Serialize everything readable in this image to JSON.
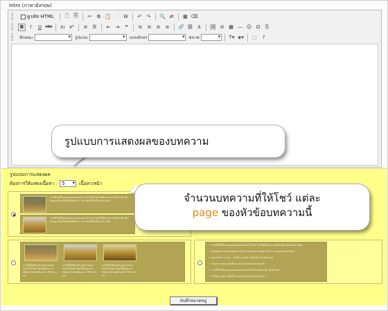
{
  "section_label": "Intro (ภาษาอังกฤษ)",
  "toolbar": {
    "source_label": "ดูรหัส HTML",
    "row2_buttons": [
      "B",
      "I",
      "U",
      "ABC",
      "x₂",
      "x²"
    ],
    "style_label": "ลักษณะ",
    "format_label": "รูปแบบ",
    "font_label": "แบบอักษร",
    "size_label": "ขนาด"
  },
  "callout_top": "รูปแบบการแสดงผลของบทความ",
  "format_panel": {
    "title": "รูปแบบการแสดงผล",
    "count_label": "ต้องการให้แสดงเนื้อหา :",
    "count_value": "5",
    "count_suffix": "เนื้อหา/หน้า"
  },
  "option1": {
    "selected": true,
    "items": [
      "ภาพนี้ใช้เพื่อแสดงรูปแบบของหน้าเว็บไซต์ โดยใช้ข้อความ Mollis Bit ชุดตัวอย่างไทยใช้ไทยได้เพียง 5 บท เพิ่มให้ไปที่ไหนก็อ่านได้",
      "ภาพนี้ใช้เพื่อแสดงรูปแบบของหน้าเว็บไซต์ โดยใช้ข้อความ Mollis Bit ชุดตัวอย่างไทยใช้ไทยได้เพียง 5 บท เพิ่มให้ไปที่ไหนก็อ่านได้"
    ]
  },
  "option2": {
    "selected": false,
    "items": [
      "ภาพนี้ใช้เพื่อแสดงรูปแบบของหน้าเว็บไซต์ โดยใช้ข้อความ Mollis Bit ชุดตัวอย่าง ใช้งาน 5 บท",
      "ภาพนี้ใช้เพื่อแสดงรูปแบบของหน้าเว็บไซต์ โดยใช้ข้อความ Mollis Bit ชุดตัวอย่าง ใช้งาน 5 บท",
      "ภาพนี้ใช้เพื่อแสดงรูปแบบของหน้าเว็บไซต์ โดยใช้ข้อความ Mollis Bit ชุดตัวอย่าง ใช้งาน 5 บท"
    ]
  },
  "option3": {
    "selected": false,
    "items": [
      "ภาพนี้ใช้เพื่อแสดงรูปแบบของหน้าเว็บไซต์ โดยใช้ข้อความ Mollis Bit ชุดตัวอย่างไทย",
      "Bangkok International Toys & Games Show 2007 และของเล่นของไทย",
      "ซูเปอร์ตำรวจ แม็ก - มือถือ ยามเช้า (Middle Childhood)",
      "Flytech ชุดแรงยิ่งนั้นแบบของโฟมเด็กหลายคนทำ",
      "ภาพนี้ใช้เพื่อแสดงรูปแบบของหน้าเว็บไซต์ Mollis Bit ชุดตัวอย่าง",
      "Flytech ชุดแรงยิ่งนั้นแบบของโฟมเด็กหลายคนทำ"
    ]
  },
  "callout_bottom": {
    "line1": "จำนวนบทความที่ให้โชว์ แต่ละ",
    "line2_accent": "page",
    "line2_rest": " ของหัวข้อบทความนี้"
  },
  "save_label": "บันทึกหมวดหมู่"
}
